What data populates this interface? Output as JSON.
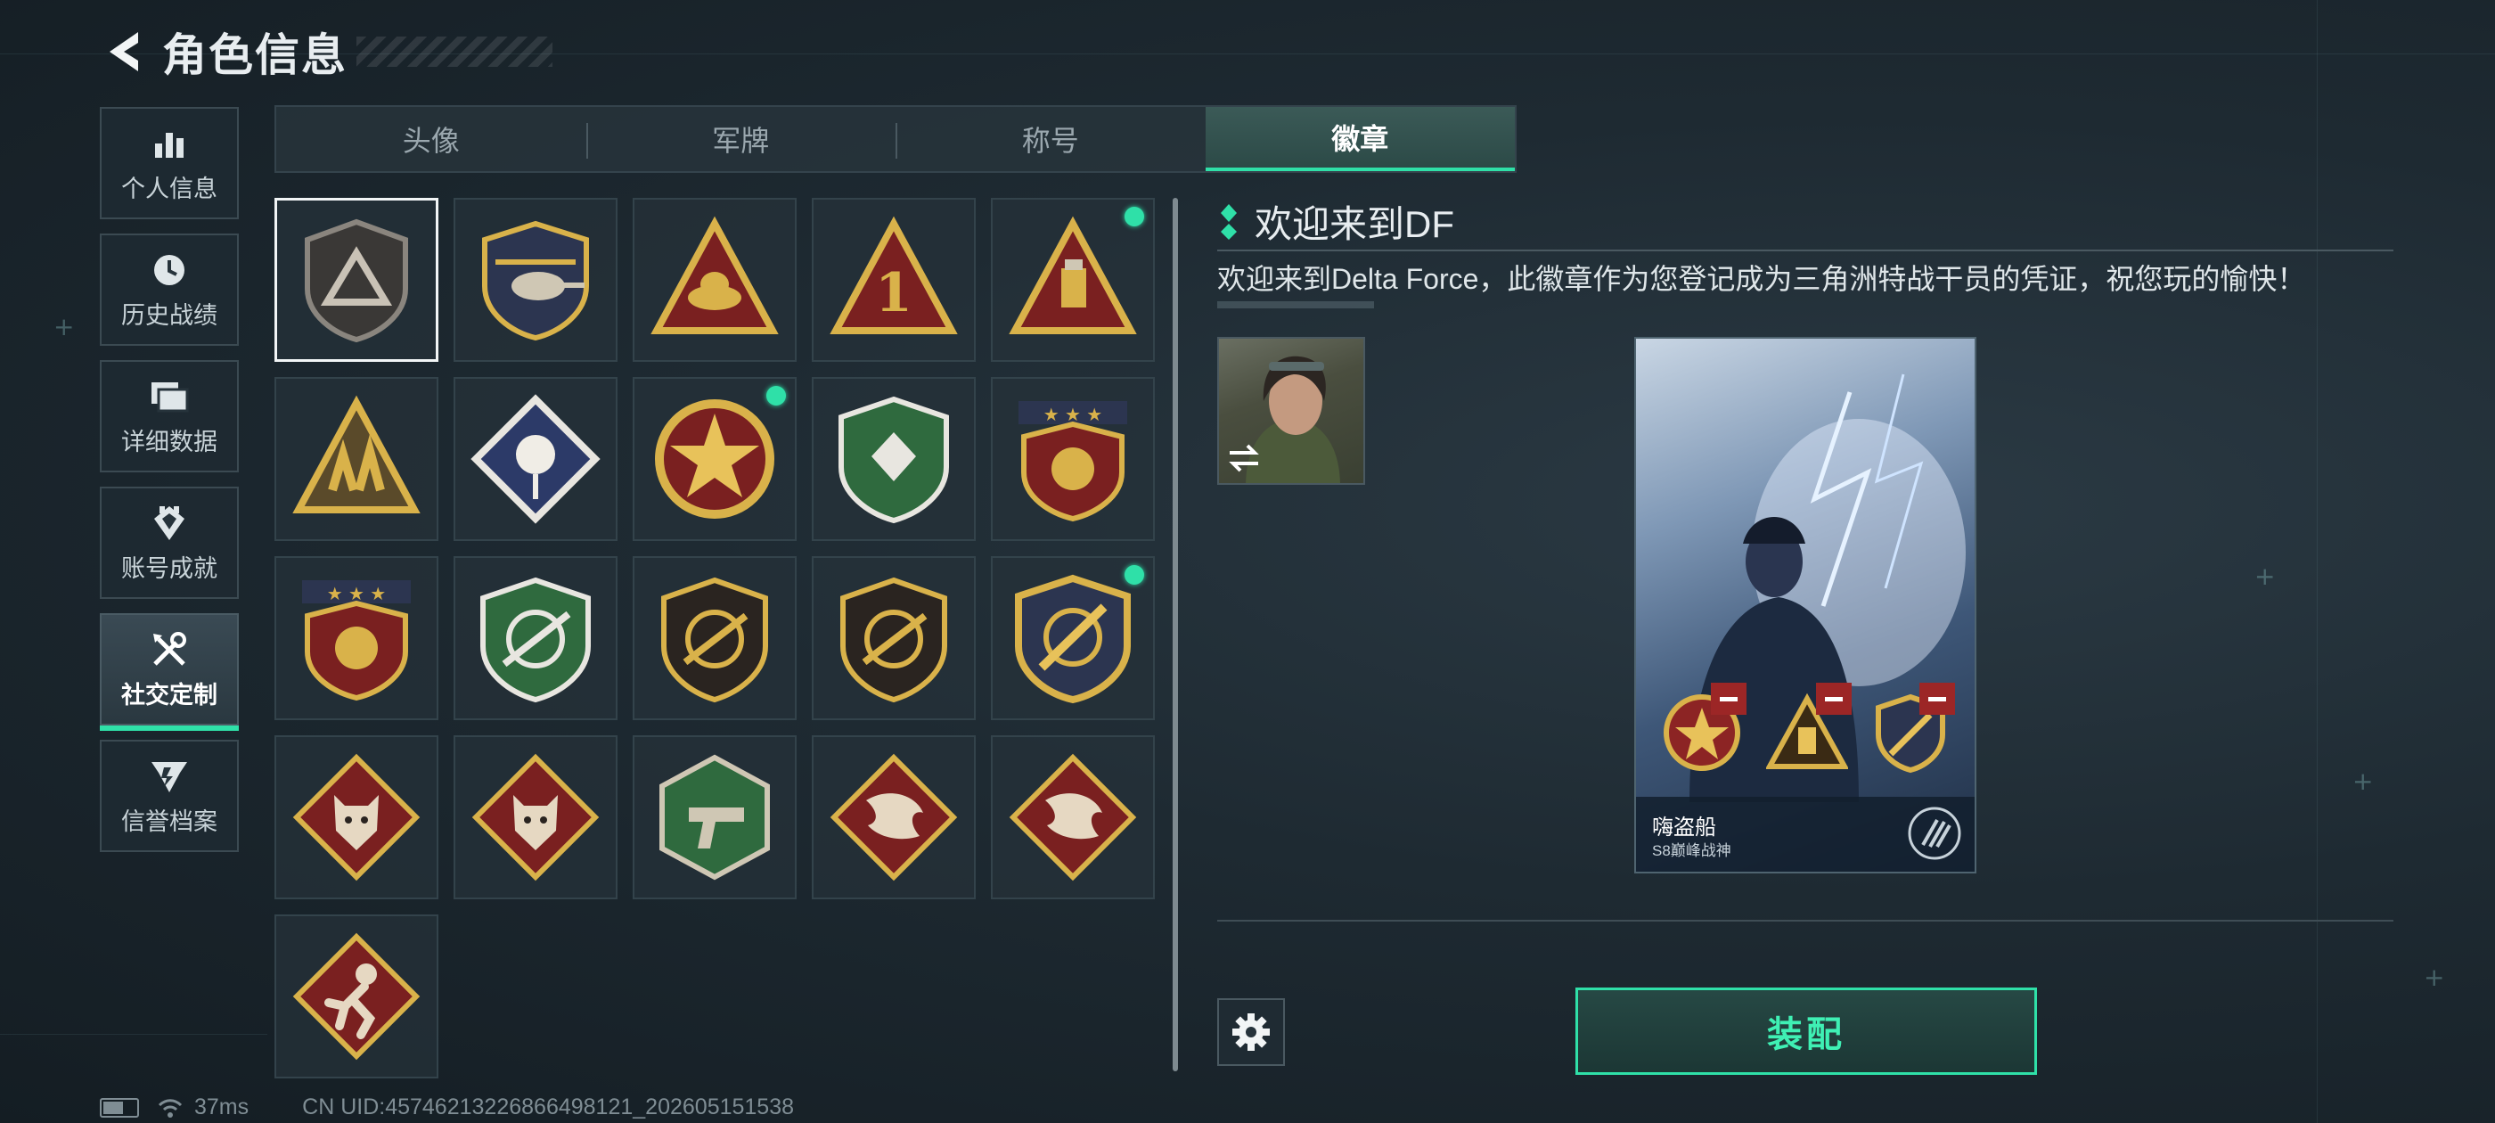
{
  "header": {
    "title": "角色信息"
  },
  "sidebar": {
    "items": [
      {
        "label": "个人信息",
        "icon": "bar-chart-icon"
      },
      {
        "label": "历史战绩",
        "icon": "clock-icon"
      },
      {
        "label": "详细数据",
        "icon": "folder-icon"
      },
      {
        "label": "账号成就",
        "icon": "achievement-icon"
      },
      {
        "label": "社交定制",
        "icon": "tools-icon",
        "active": true
      },
      {
        "label": "信誉档案",
        "icon": "credit-icon"
      }
    ]
  },
  "tabs": [
    {
      "label": "头像"
    },
    {
      "label": "军牌"
    },
    {
      "label": "称号"
    },
    {
      "label": "徽章",
      "active": true
    }
  ],
  "badges": [
    {
      "id": "b1",
      "type": "shield-triangle",
      "selected": true,
      "new": false
    },
    {
      "id": "b2",
      "type": "helicopter-shield",
      "new": false
    },
    {
      "id": "b3",
      "type": "triangle-lotus",
      "new": false
    },
    {
      "id": "b4",
      "type": "triangle-one",
      "new": false
    },
    {
      "id": "b5",
      "type": "triangle-usb",
      "new": true
    },
    {
      "id": "b6",
      "type": "triangle-soldiers",
      "new": false
    },
    {
      "id": "b7",
      "type": "diamond-rose",
      "new": false
    },
    {
      "id": "b8",
      "type": "round-star",
      "new": true
    },
    {
      "id": "b9",
      "type": "green-shield",
      "new": false
    },
    {
      "id": "b10",
      "type": "red-shield-stars",
      "new": false
    },
    {
      "id": "b11",
      "type": "red-shield-gem",
      "new": false
    },
    {
      "id": "b12",
      "type": "green-rifle-shield",
      "new": false
    },
    {
      "id": "b13",
      "type": "dark-rifle-shield",
      "new": false
    },
    {
      "id": "b14",
      "type": "dark-rifle-shield-2",
      "new": false
    },
    {
      "id": "b15",
      "type": "gold-knife-shield",
      "new": true
    },
    {
      "id": "b16",
      "type": "diamond-wolf",
      "new": false
    },
    {
      "id": "b17",
      "type": "diamond-wolf-2",
      "new": false
    },
    {
      "id": "b18",
      "type": "hex-green-pistol",
      "new": false
    },
    {
      "id": "b19",
      "type": "diamond-dragon",
      "new": false
    },
    {
      "id": "b20",
      "type": "diamond-dragon-2",
      "new": false
    },
    {
      "id": "b21",
      "type": "diamond-runner",
      "new": false
    }
  ],
  "detail": {
    "title": "欢迎来到DF",
    "description": "欢迎来到Delta Force，此徽章作为您登记成为三角洲特战干员的凭证，祝您玩的愉快！"
  },
  "preview": {
    "player_name": "嗨盗船",
    "rank": "S8巅峰战神"
  },
  "equip_label": "装配",
  "status": {
    "ping": "37ms",
    "uid": "CN UID:4574621322686649812​1_202605151538"
  },
  "colors": {
    "accent": "#2fe0a8",
    "remove": "#9c2626"
  }
}
